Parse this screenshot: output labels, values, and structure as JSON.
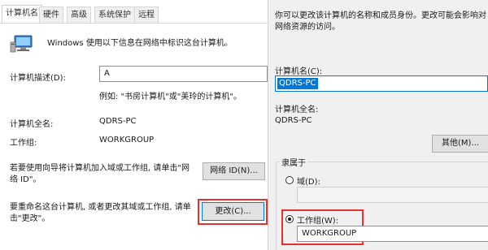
{
  "system_props": {
    "tabs": [
      "计算机名",
      "硬件",
      "高级",
      "系统保护",
      "远程"
    ],
    "intro_text": "Windows 使用以下信息在网络中标识这台计算机。",
    "desc_label": "计算机描述(D):",
    "desc_value": "A",
    "desc_example": "例如: \"书房计算机\"或\"美玲的计算机\"。",
    "fullname_label": "计算机全名:",
    "fullname_value": "QDRS-PC",
    "workgroup_label": "工作组:",
    "workgroup_value": "WORKGROUP",
    "network_id_text": "若要使用向导将计算机加入域或工作组, 请单击\"网络 ID\"。",
    "network_id_button": "网络 ID(N)...",
    "rename_text": "要重命名这台计算机, 或者更改其域或工作组, 请单击\"更改\"。",
    "change_button": "更改(C)..."
  },
  "rename_dialog": {
    "intro_text": "你可以更改该计算机的名称和成员身份。更改可能会影响对网络资源的访问。",
    "name_label": "计算机名(C):",
    "name_value": "QDRS-PC",
    "fullname_label": "计算机全名:",
    "fullname_value": "QDRS-PC",
    "more_button": "其他(M)...",
    "member_of_label": "隶属于",
    "domain_label": "域(D):",
    "domain_value": "",
    "workgroup_label": "工作组(W):",
    "workgroup_value": "WORKGROUP",
    "selected_option": "工作组(W):"
  },
  "colors": {
    "highlight_frame": "#e5322e",
    "selection": "#0078d7"
  },
  "icons": {
    "computer": "computer-monitor-icon"
  }
}
